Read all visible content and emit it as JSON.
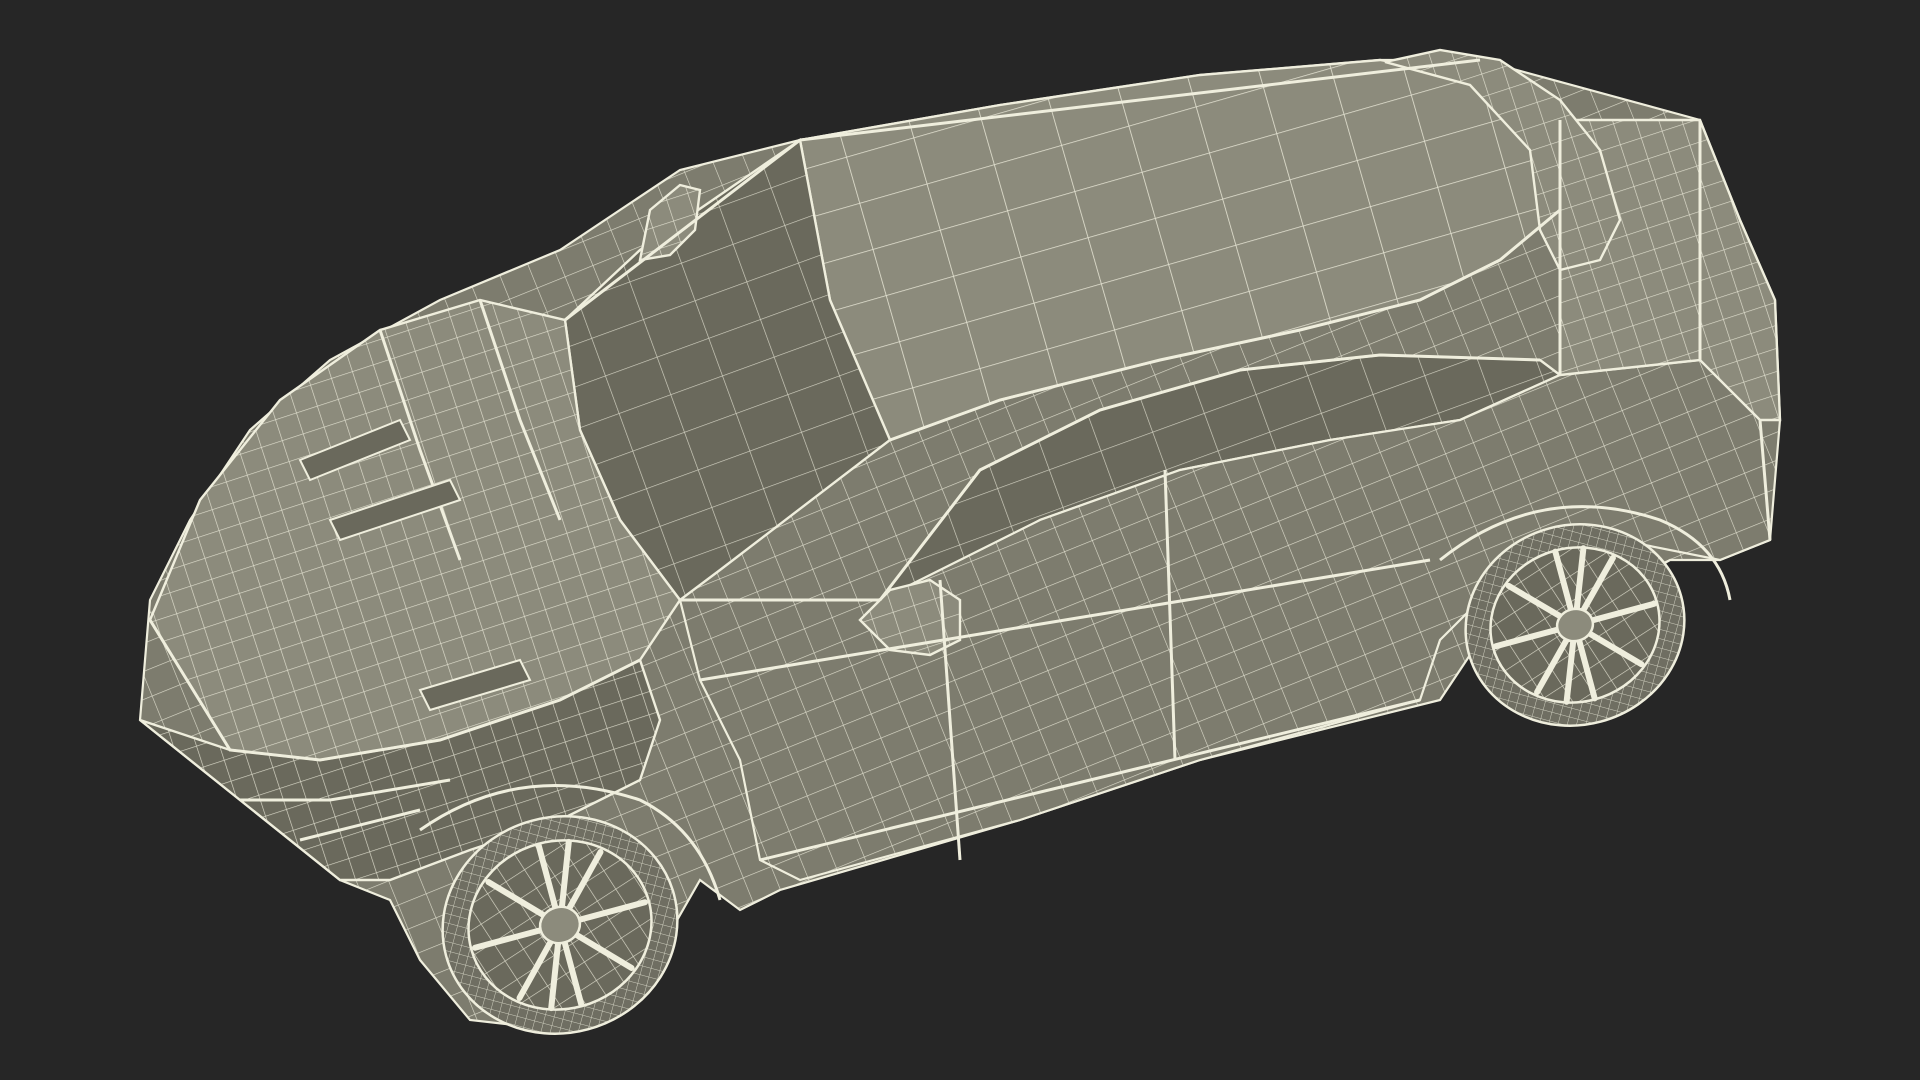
{
  "render": {
    "background_color": "#262626",
    "surface_color": "#7d7c6e",
    "surface_shadow_color": "#6a695c",
    "surface_highlight_color": "#8c8b7c",
    "wire_color": "#efeedd",
    "tire_color": "#6f6e62"
  },
  "subject": {
    "icon": "wireframe-suv-model"
  }
}
